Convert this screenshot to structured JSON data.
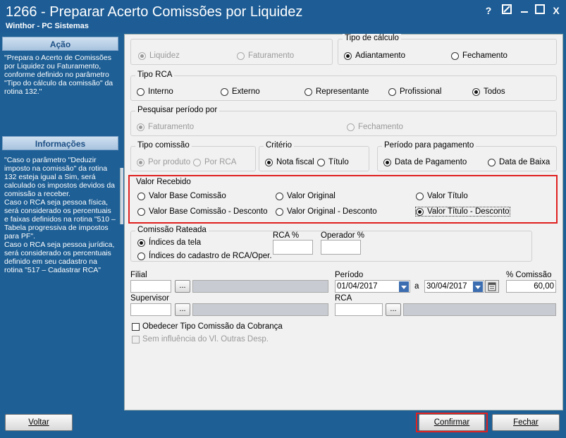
{
  "window": {
    "title": "1266 - Preparar Acerto Comissões por Liquidez",
    "subtitle": "Winthor - PC Sistemas",
    "help_glyph": "?",
    "close_glyph": "X"
  },
  "left_panel": {
    "acao_header": "Ação",
    "acao_text": "\"Prepara o Acerto de Comissões por Liquidez ou Faturamento, conforme definido no parâmetro \"Tipo do cálculo da comissão\" da rotina 132.\"",
    "info_header": "Informações",
    "info_text": "\"Caso o parâmetro \"Deduzir imposto na comissão\" da rotina 132 esteja igual a Sim, será calculado os impostos devidos da comissão a receber.\nCaso o RCA seja pessoa física, será considerado os percentuais e faixas definidos na rotina \"510 – Tabela progressiva de impostos para PF\".\nCaso o RCA seja pessoa jurídica, será considerado os percentuais definido em seu cadastro na rotina \"517 – Cadastrar RCA\""
  },
  "form": {
    "tipo_top": {
      "liquidez": "Liquidez",
      "faturamento": "Faturamento"
    },
    "tipo_calculo": {
      "title": "Tipo de cálculo",
      "adiantamento": "Adiantamento",
      "fechamento": "Fechamento"
    },
    "tipo_rca": {
      "title": "Tipo RCA",
      "interno": "Interno",
      "externo": "Externo",
      "representante": "Representante",
      "profissional": "Profissional",
      "todos": "Todos"
    },
    "pesquisar": {
      "title": "Pesquisar período por",
      "faturamento": "Faturamento",
      "fechamento": "Fechamento"
    },
    "tipo_comissao": {
      "title": "Tipo comissão",
      "por_produto": "Por produto",
      "por_rca": "Por RCA"
    },
    "criterio": {
      "title": "Critério",
      "nota_fiscal": "Nota fiscal",
      "titulo": "Título"
    },
    "periodo_pagamento": {
      "title": "Período para pagamento",
      "data_pagamento": "Data de Pagamento",
      "data_baixa": "Data de Baixa"
    },
    "valor_recebido": {
      "title": "Valor Recebido",
      "base_comissao": "Valor Base Comissão",
      "original": "Valor Original",
      "titulo": "Valor Título",
      "base_comissao_desc": "Valor Base Comissão - Desconto",
      "original_desc": "Valor Original - Desconto",
      "titulo_desc": "Valor Título - Desconto"
    },
    "comissao_rateada": {
      "title": "Comissão Rateada",
      "indices_tela": "Índices da tela",
      "indices_cadastro": "Índices do cadastro de RCA/Oper.",
      "rca_pct_label": "RCA %",
      "operador_pct_label": "Operador %"
    },
    "filial_label": "Filial",
    "periodo_label": "Período",
    "periodo_de": "01/04/2017",
    "periodo_a_label": "a",
    "periodo_ate": "30/04/2017",
    "pct_comissao_label": "% Comissão",
    "pct_comissao_value": "60,00",
    "supervisor_label": "Supervisor",
    "rca_label": "RCA",
    "ellipsis": "...",
    "obedecer_label": "Obedecer Tipo Comissão da Cobrança",
    "sem_influencia_label": "Sem influência do Vl. Outras Desp."
  },
  "buttons": {
    "voltar": "Voltar",
    "confirmar": "Confirmar",
    "fechar": "Fechar"
  },
  "colors": {
    "title_bar": "#1d5c95",
    "highlight": "#e02020",
    "panel": "#f1f1f1"
  }
}
